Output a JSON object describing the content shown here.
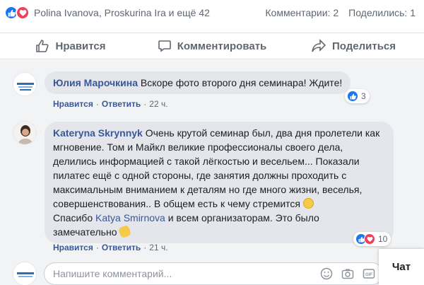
{
  "summary": {
    "reactors": "Polina Ivanova, Proskurina Ira и ещё 42",
    "comments": "Комментарии: 2",
    "shares": "Поделились: 1"
  },
  "actions": {
    "like": "Нравится",
    "comment": "Комментировать",
    "share": "Поделиться"
  },
  "comments": [
    {
      "author": "Юлия Марочкина",
      "text": "Вскоре фото второго дня семинара! Ждите!",
      "like": "Нравится",
      "reply": "Ответить",
      "time": "22 ч.",
      "reactions_count": "3",
      "avatar_icon": "logo-avatar-icon"
    },
    {
      "author": "Kateryna Skrynnyk",
      "text_1": "Очень крутой семинар был, два дня пролетели как мгновение. Том и Майкл великие профессионалы своего дела, делились информацией с такой лёгкостью и весельем... Показали пилатес ещё с одной стороны, где занятия должны проходить с максимальным вниманием к деталям но где много жизни, веселья, совершенствования.. В общем есть к чему стремится",
      "text_2": "Спасибо",
      "mention": "Katya Smirnova",
      "text_3": "и всем организаторам. Это было замечательно",
      "like": "Нравится",
      "reply": "Ответить",
      "time": "21 ч.",
      "reactions_count": "10",
      "avatar_icon": "user-photo-avatar"
    }
  ],
  "input": {
    "placeholder": "Напишите комментарий..."
  },
  "chat": {
    "label": "Чат"
  },
  "colors": {
    "like_blue": "#1877f2",
    "love_red": "#f33e58",
    "link": "#385898",
    "bubble": "#e4e6eb",
    "panel": "#f2f3f5"
  }
}
